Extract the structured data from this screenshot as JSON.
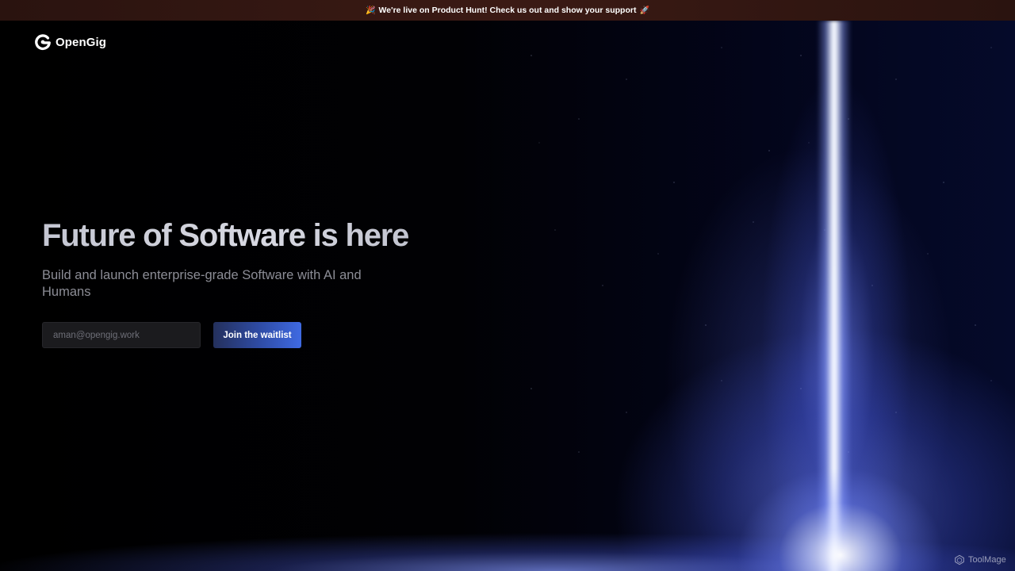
{
  "announcement": {
    "left_emoji": "🎉",
    "text": "We're live on Product Hunt! Check us out and show your support",
    "right_emoji": "🚀"
  },
  "logo": {
    "name": "OpenGig",
    "icon": "opengig-logo-icon"
  },
  "hero": {
    "title": "Future of Software is here",
    "subtitle": "Build and launch enterprise-grade Software with AI and Humans"
  },
  "waitlist": {
    "email_placeholder": "aman@opengig.work",
    "button_label": "Join the waitlist"
  },
  "watermark": {
    "text": "ToolMage",
    "icon": "toolmage-logo-icon"
  },
  "colors": {
    "background": "#020206",
    "announcement_bar": "#3b1a14",
    "accent_blue": "#3f6ae2",
    "title_text": "#c9cbd6",
    "subtitle_text": "#8c8d96",
    "input_background": "#1b1b1e"
  }
}
